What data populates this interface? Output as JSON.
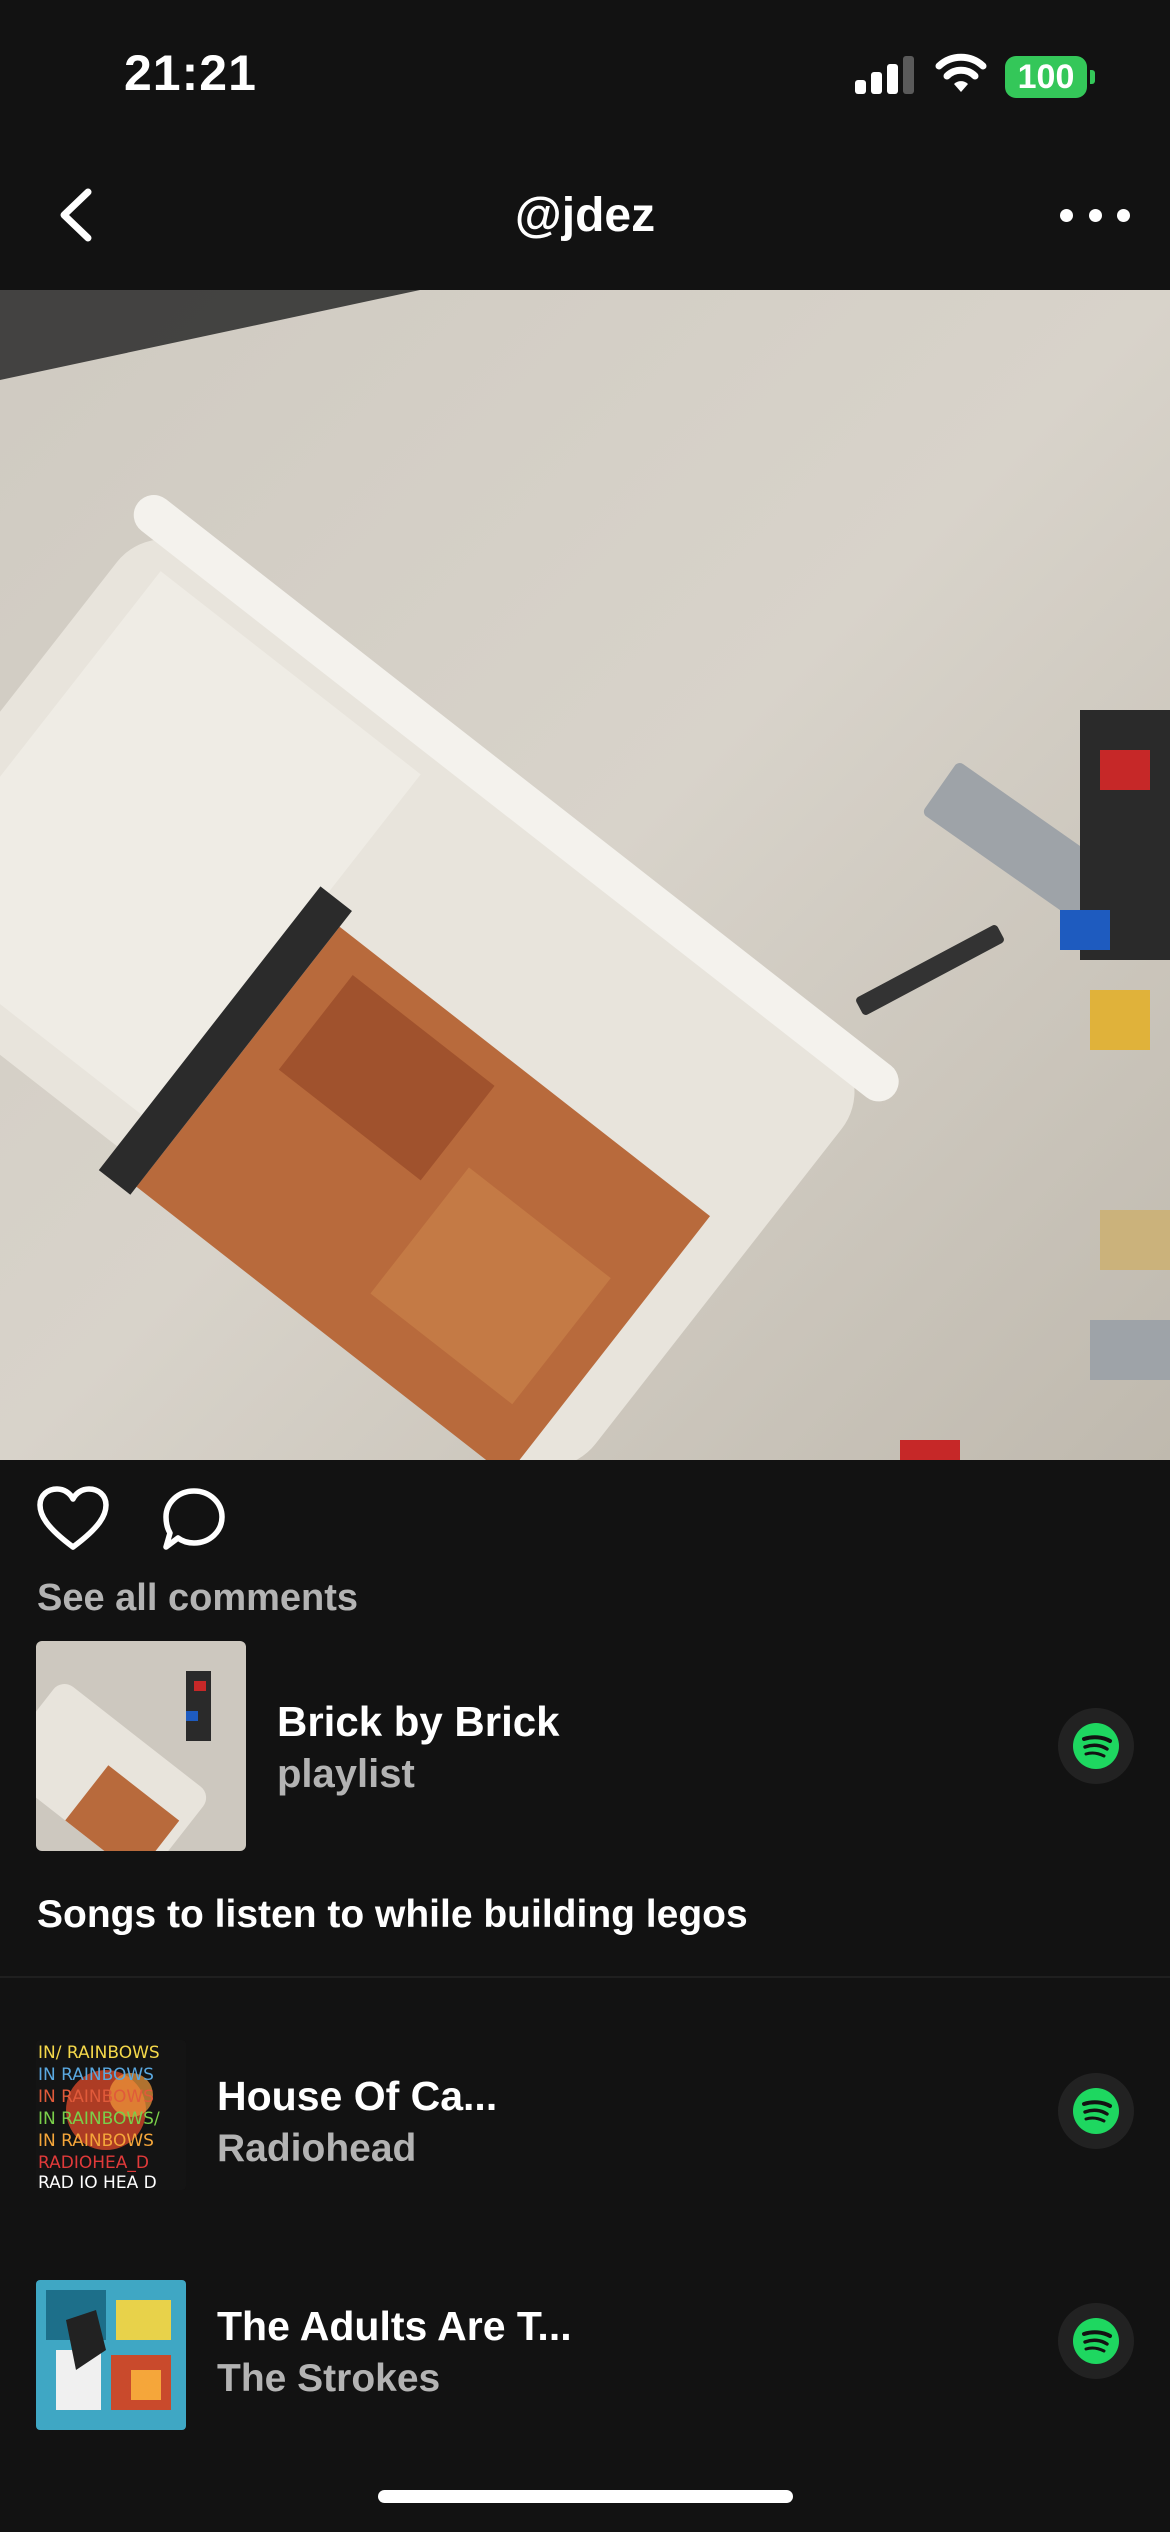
{
  "status_bar": {
    "time": "21:21",
    "battery": "100",
    "battery_color": "#34c759"
  },
  "header": {
    "title": "@jdez",
    "back_icon": "chevron-left-icon",
    "more_icon": "ellipsis-icon"
  },
  "post": {
    "image_alt": "Lego build photo",
    "like_icon": "heart-icon",
    "comment_icon": "speech-bubble-icon",
    "see_comments": "See all comments"
  },
  "playlist": {
    "title": "Brick by Brick",
    "type": "playlist",
    "description": "Songs to listen to while building legos",
    "service_icon": "spotify-icon"
  },
  "tracks": [
    {
      "title": "House Of Ca...",
      "artist": "Radiohead",
      "art_text": [
        "IN/ RAINBOWS",
        "IN RAINBOWS",
        "IN RAINBOWS",
        "IN RAINBOWS/",
        "IN RAINBOWS",
        "RADIOHEA_D",
        "RAD IO HEA D"
      ]
    },
    {
      "title": "The Adults Are T...",
      "artist": "The Strokes"
    }
  ],
  "colors": {
    "background": "#121212",
    "secondary_text": "#b3b3b3",
    "spotify_green": "#1ed760"
  }
}
